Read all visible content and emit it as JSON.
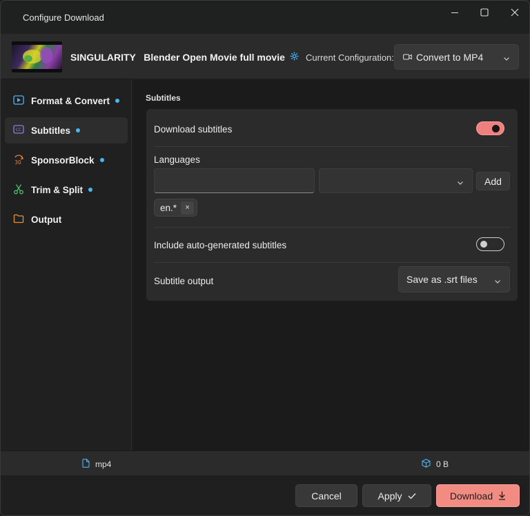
{
  "window": {
    "title": "Configure Download"
  },
  "header": {
    "video_title": "SINGULARITY   Blender Open Movie full movie",
    "config_label": "Current Configuration:",
    "config_value": "Convert to MP4"
  },
  "sidebar": {
    "items": [
      {
        "label": "Format & Convert",
        "icon": "play-box-icon",
        "modified": true
      },
      {
        "label": "Subtitles",
        "icon": "cc-icon",
        "modified": true,
        "active": true
      },
      {
        "label": "SponsorBlock",
        "icon": "sponsorblock-icon",
        "modified": true
      },
      {
        "label": "Trim & Split",
        "icon": "scissors-icon",
        "modified": true
      },
      {
        "label": "Output",
        "icon": "folder-icon",
        "modified": false
      }
    ]
  },
  "subtitles": {
    "section_title": "Subtitles",
    "download_label": "Download subtitles",
    "download_enabled": true,
    "languages_label": "Languages",
    "language_input_value": "",
    "language_select_value": "",
    "add_label": "Add",
    "chips": [
      {
        "label": "en.*",
        "remove": "×"
      }
    ],
    "autogen_label": "Include auto-generated subtitles",
    "autogen_enabled": false,
    "output_label": "Subtitle output",
    "output_value": "Save as .srt files"
  },
  "status": {
    "format": "mp4",
    "size": "0 B"
  },
  "footer": {
    "cancel": "Cancel",
    "apply": "Apply",
    "download": "Download"
  },
  "colors": {
    "accent": "#f28b82",
    "dot": "#4cb5f5"
  }
}
